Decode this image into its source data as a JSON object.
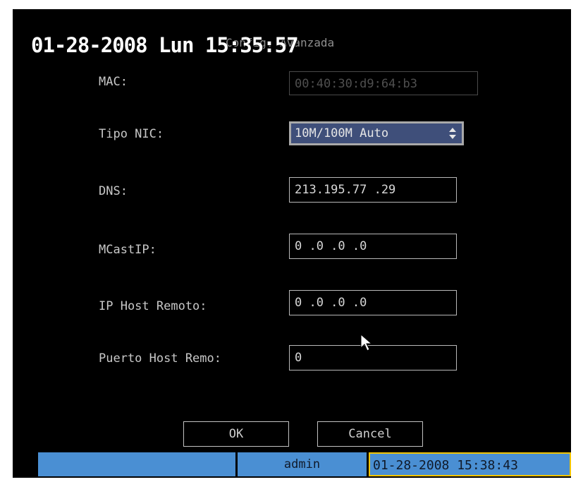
{
  "osd": {
    "datetime": "01-28-2008 Lun 15:35:57"
  },
  "dialog": {
    "title": "Config. Avanzada",
    "fields": {
      "mac": {
        "label": "MAC:",
        "value": "00:40:30:d9:64:b3"
      },
      "nic": {
        "label": "Tipo NIC:",
        "value": "10M/100M Auto"
      },
      "dns": {
        "label": "DNS:",
        "value": "213.195.77 .29"
      },
      "mcast": {
        "label": "MCastIP:",
        "value": "0  .0  .0  .0"
      },
      "remote_ip": {
        "label": "IP Host Remoto:",
        "value": "0  .0  .0  .0"
      },
      "remote_port": {
        "label": "Puerto Host Remo:",
        "value": "0"
      }
    },
    "buttons": {
      "ok": "OK",
      "cancel": "Cancel"
    }
  },
  "statusbar": {
    "user": "admin",
    "datetime": "01-28-2008 15:38:43"
  },
  "colors": {
    "background": "#000000",
    "statusbar": "#4a8fd3",
    "select_bg": "#3f4f7a",
    "highlight": "#f2c400"
  }
}
